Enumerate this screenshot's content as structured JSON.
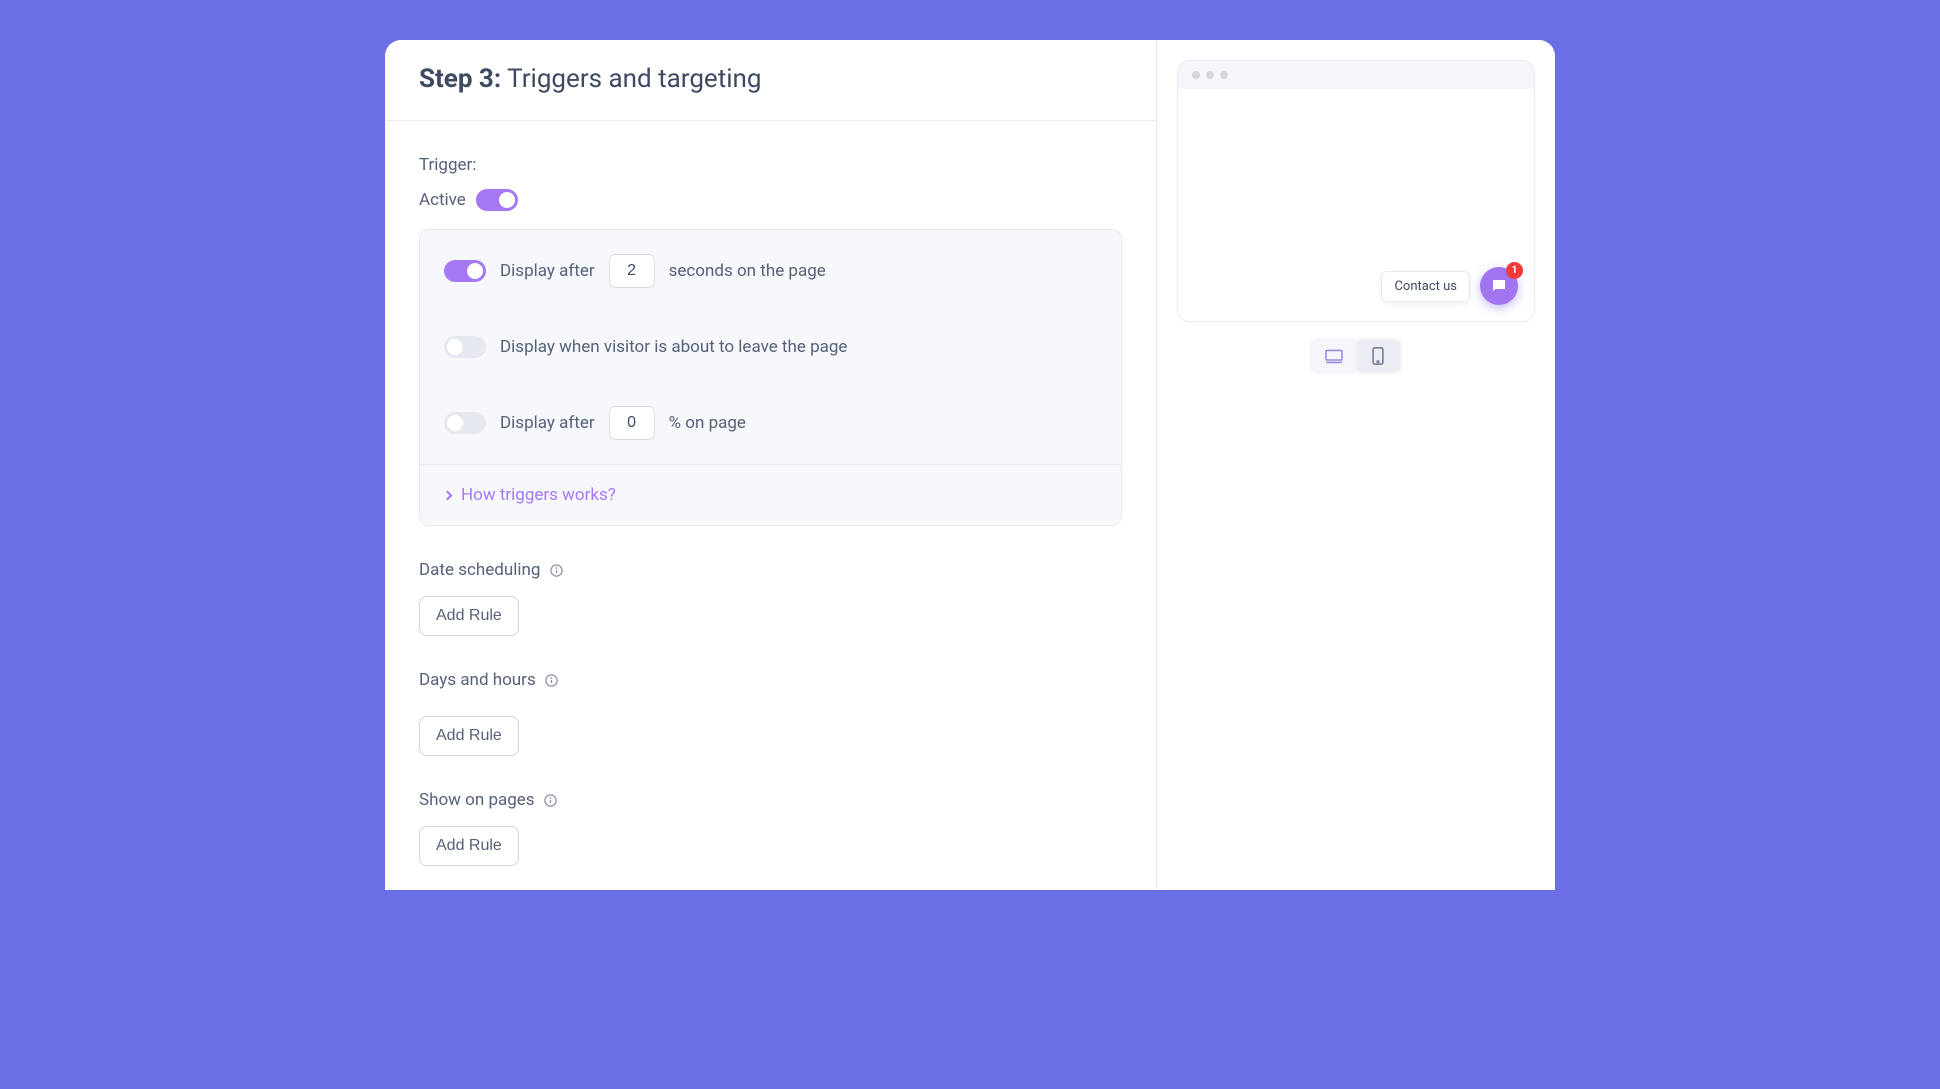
{
  "header": {
    "step_prefix": "Step 3:",
    "step_title": "Triggers and targeting"
  },
  "trigger": {
    "label": "Trigger:",
    "active_label": "Active",
    "active_on": true,
    "rows": [
      {
        "label_before": "Display after",
        "value": "2",
        "label_after": "seconds on the page",
        "on": true,
        "has_input": true
      },
      {
        "label_before": "Display when visitor is about to leave the page",
        "value": "",
        "label_after": "",
        "on": false,
        "has_input": false
      },
      {
        "label_before": "Display after",
        "value": "0",
        "label_after": "% on page",
        "on": false,
        "has_input": true
      }
    ],
    "help_link": "How triggers works?"
  },
  "sections": [
    {
      "label": "Date scheduling",
      "button": "Add Rule"
    },
    {
      "label": "Days and hours",
      "button": "Add Rule"
    },
    {
      "label": "Show on pages",
      "button": "Add Rule"
    }
  ],
  "preview": {
    "contact_label": "Contact us",
    "badge_count": "1"
  },
  "colors": {
    "accent": "#a678f4",
    "bg": "#6b6ee5"
  }
}
